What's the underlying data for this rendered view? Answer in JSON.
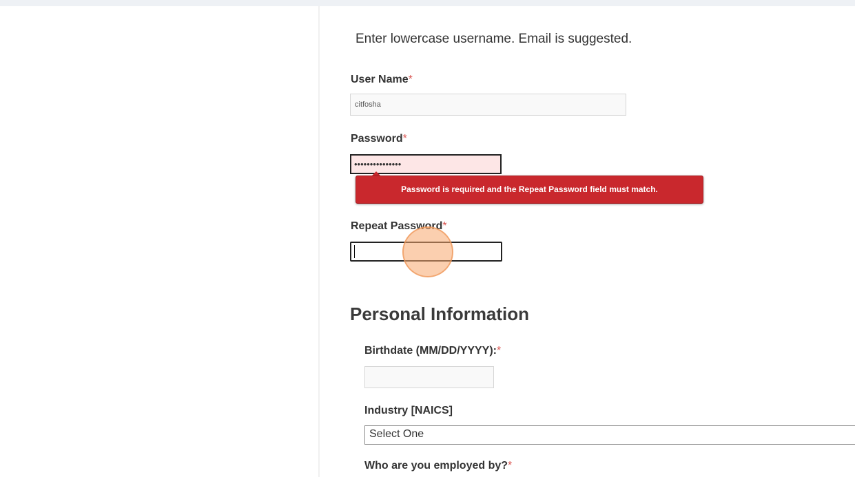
{
  "form": {
    "instructions": "Enter lowercase username.  Email is suggested.",
    "required_marker": "*",
    "username": {
      "label": "User Name",
      "value": "citfosha"
    },
    "password": {
      "label": "Password",
      "value": "•••••••••••••••",
      "error": "Password is required and the Repeat Password field must match."
    },
    "repeat_password": {
      "label": "Repeat Password",
      "value": ""
    }
  },
  "personal_info": {
    "heading": "Personal Information",
    "birthdate": {
      "label": "Birthdate (MM/DD/YYYY):",
      "value": ""
    },
    "industry": {
      "label": "Industry [NAICS]",
      "selected": "Select One"
    },
    "employer": {
      "label": "Who are you employed by?"
    }
  },
  "colors": {
    "error_bg": "#c9282d",
    "required": "#d9534f",
    "invalid_field_bg": "#fde6e6",
    "click_indicator": "#f7a86e"
  }
}
